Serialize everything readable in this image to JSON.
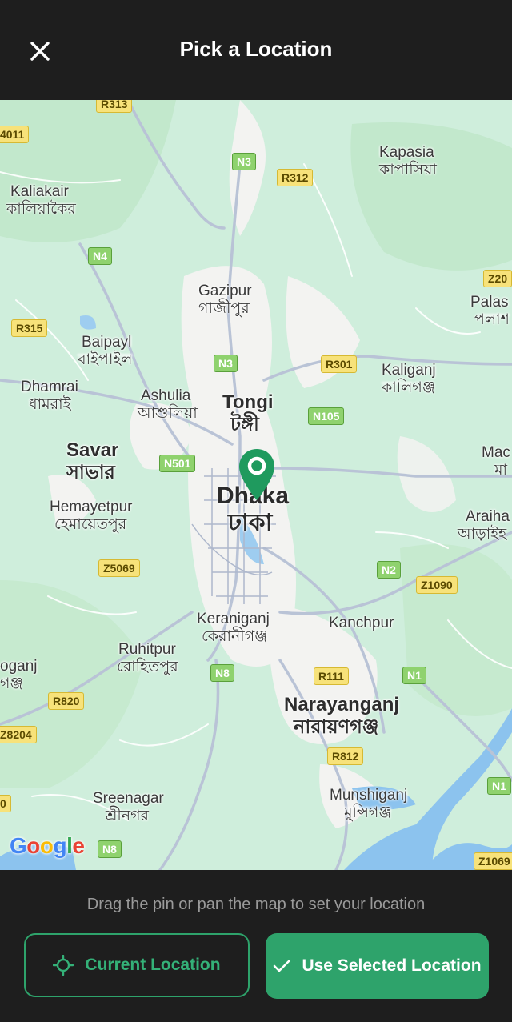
{
  "header": {
    "title": "Pick a Location",
    "close_icon": "close-icon"
  },
  "map": {
    "places": [
      {
        "key": "kapasia",
        "en": "Kapasia",
        "bn": "কাপাসিয়া"
      },
      {
        "key": "kaliakair",
        "en": "Kaliakair",
        "bn": "কালিয়াকৈর"
      },
      {
        "key": "gazipur",
        "en": "Gazipur",
        "bn": "গাজীপুর"
      },
      {
        "key": "palash",
        "en": "Palas",
        "bn": "পলাশ"
      },
      {
        "key": "baipayl",
        "en": "Baipayl",
        "bn": "বাইপাইল"
      },
      {
        "key": "dhamrai",
        "en": "Dhamrai",
        "bn": "ধামরাই"
      },
      {
        "key": "ashulia",
        "en": "Ashulia",
        "bn": "আশুলিয়া"
      },
      {
        "key": "tongi",
        "en": "Tongi",
        "bn": "টঙ্গী"
      },
      {
        "key": "kaliganj",
        "en": "Kaliganj",
        "bn": "কালিগঞ্জ"
      },
      {
        "key": "savar",
        "en": "Savar",
        "bn": "সাভার"
      },
      {
        "key": "madhabdi",
        "en": "Mac",
        "bn": "মা"
      },
      {
        "key": "dhaka",
        "en": "Dhaka",
        "bn": "ঢাকা"
      },
      {
        "key": "hemayetpur",
        "en": "Hemayetpur",
        "bn": "হেমায়েতপুর"
      },
      {
        "key": "araihazar",
        "en": "Araiha",
        "bn": "আড়াইহ"
      },
      {
        "key": "keraniganj",
        "en": "Keraniganj",
        "bn": "কেরানীগঞ্জ"
      },
      {
        "key": "kanchpur",
        "en": "Kanchpur",
        "bn": ""
      },
      {
        "key": "ruhitpur",
        "en": "Ruhitpur",
        "bn": "রোহিতপুর"
      },
      {
        "key": "singair",
        "en": "oganj",
        "bn": "গঞ্জ"
      },
      {
        "key": "narayanganj",
        "en": "Narayanganj",
        "bn": "নারায়ণগঞ্জ"
      },
      {
        "key": "sreenagar",
        "en": "Sreenagar",
        "bn": "শ্রীনগর"
      },
      {
        "key": "munshiganj",
        "en": "Munshiganj",
        "bn": "মুন্সিগঞ্জ"
      }
    ],
    "roads": {
      "r313": "R313",
      "r4011": "4011",
      "n3a": "N3",
      "r312": "R312",
      "n4": "N4",
      "z20": "Z20",
      "r315": "R315",
      "n3b": "N3",
      "r301": "R301",
      "n105": "N105",
      "n501": "N501",
      "z5069": "Z5069",
      "n2": "N2",
      "z1090": "Z1090",
      "n8a": "N8",
      "r111": "R111",
      "n1a": "N1",
      "r820": "R820",
      "z8204": "Z8204",
      "r812": "R812",
      "n1b": "N1",
      "r0": "0",
      "n8b": "N8",
      "z1069": "Z1069"
    },
    "attribution": "Google",
    "pin_icon": "map-pin-icon"
  },
  "bottom": {
    "hint": "Drag the pin or pan the map to set your location",
    "current_location_label": "Current Location",
    "use_selected_label": "Use Selected Location",
    "current_icon": "crosshair-icon",
    "use_icon": "check-icon"
  },
  "colors": {
    "accent": "#2ea36b",
    "background": "#1e1e1e",
    "map_land": "#cfeedc",
    "map_urban": "#f4f4f2"
  }
}
